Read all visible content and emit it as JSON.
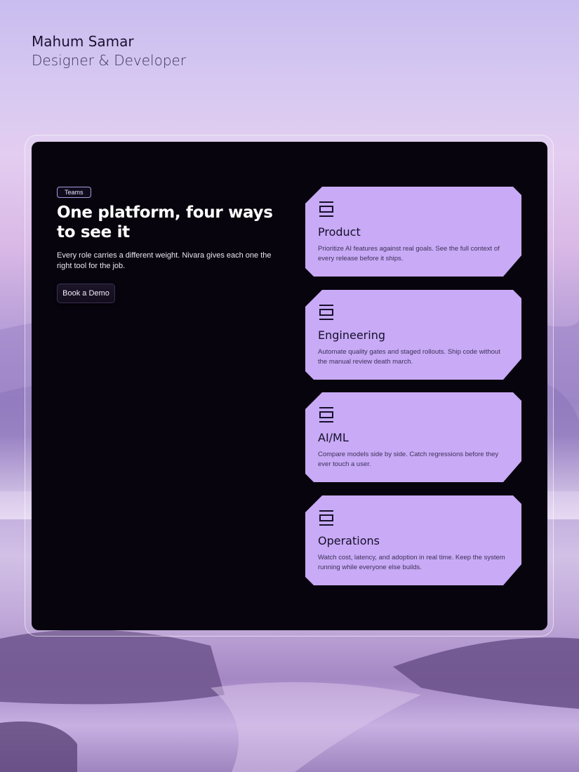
{
  "author": {
    "name": "Mahum Samar",
    "role": "Designer & Developer"
  },
  "hero": {
    "tag": "Teams",
    "headline": "One platform, four ways to see it",
    "subtext": "Every role carries a different weight. Nivara gives each one the right tool for the job.",
    "cta_label": "Book a Demo"
  },
  "cards": [
    {
      "icon": "layout-rows-icon",
      "title": "Product",
      "description": "Prioritize AI features against real goals. See the full context of every release before it ships."
    },
    {
      "icon": "layout-rows-icon",
      "title": "Engineering",
      "description": "Automate quality gates and staged rollouts. Ship code without the manual review death march."
    },
    {
      "icon": "layout-rows-icon",
      "title": "AI/ML",
      "description": "Compare models side by side. Catch regressions before they ever touch a user."
    },
    {
      "icon": "layout-rows-icon",
      "title": "Operations",
      "description": "Watch cost, latency, and adoption in real time. Keep the system running while everyone else builds."
    }
  ],
  "colors": {
    "panel": "#07040d",
    "card": "#c8aaf6",
    "accent": "#a99be0"
  }
}
